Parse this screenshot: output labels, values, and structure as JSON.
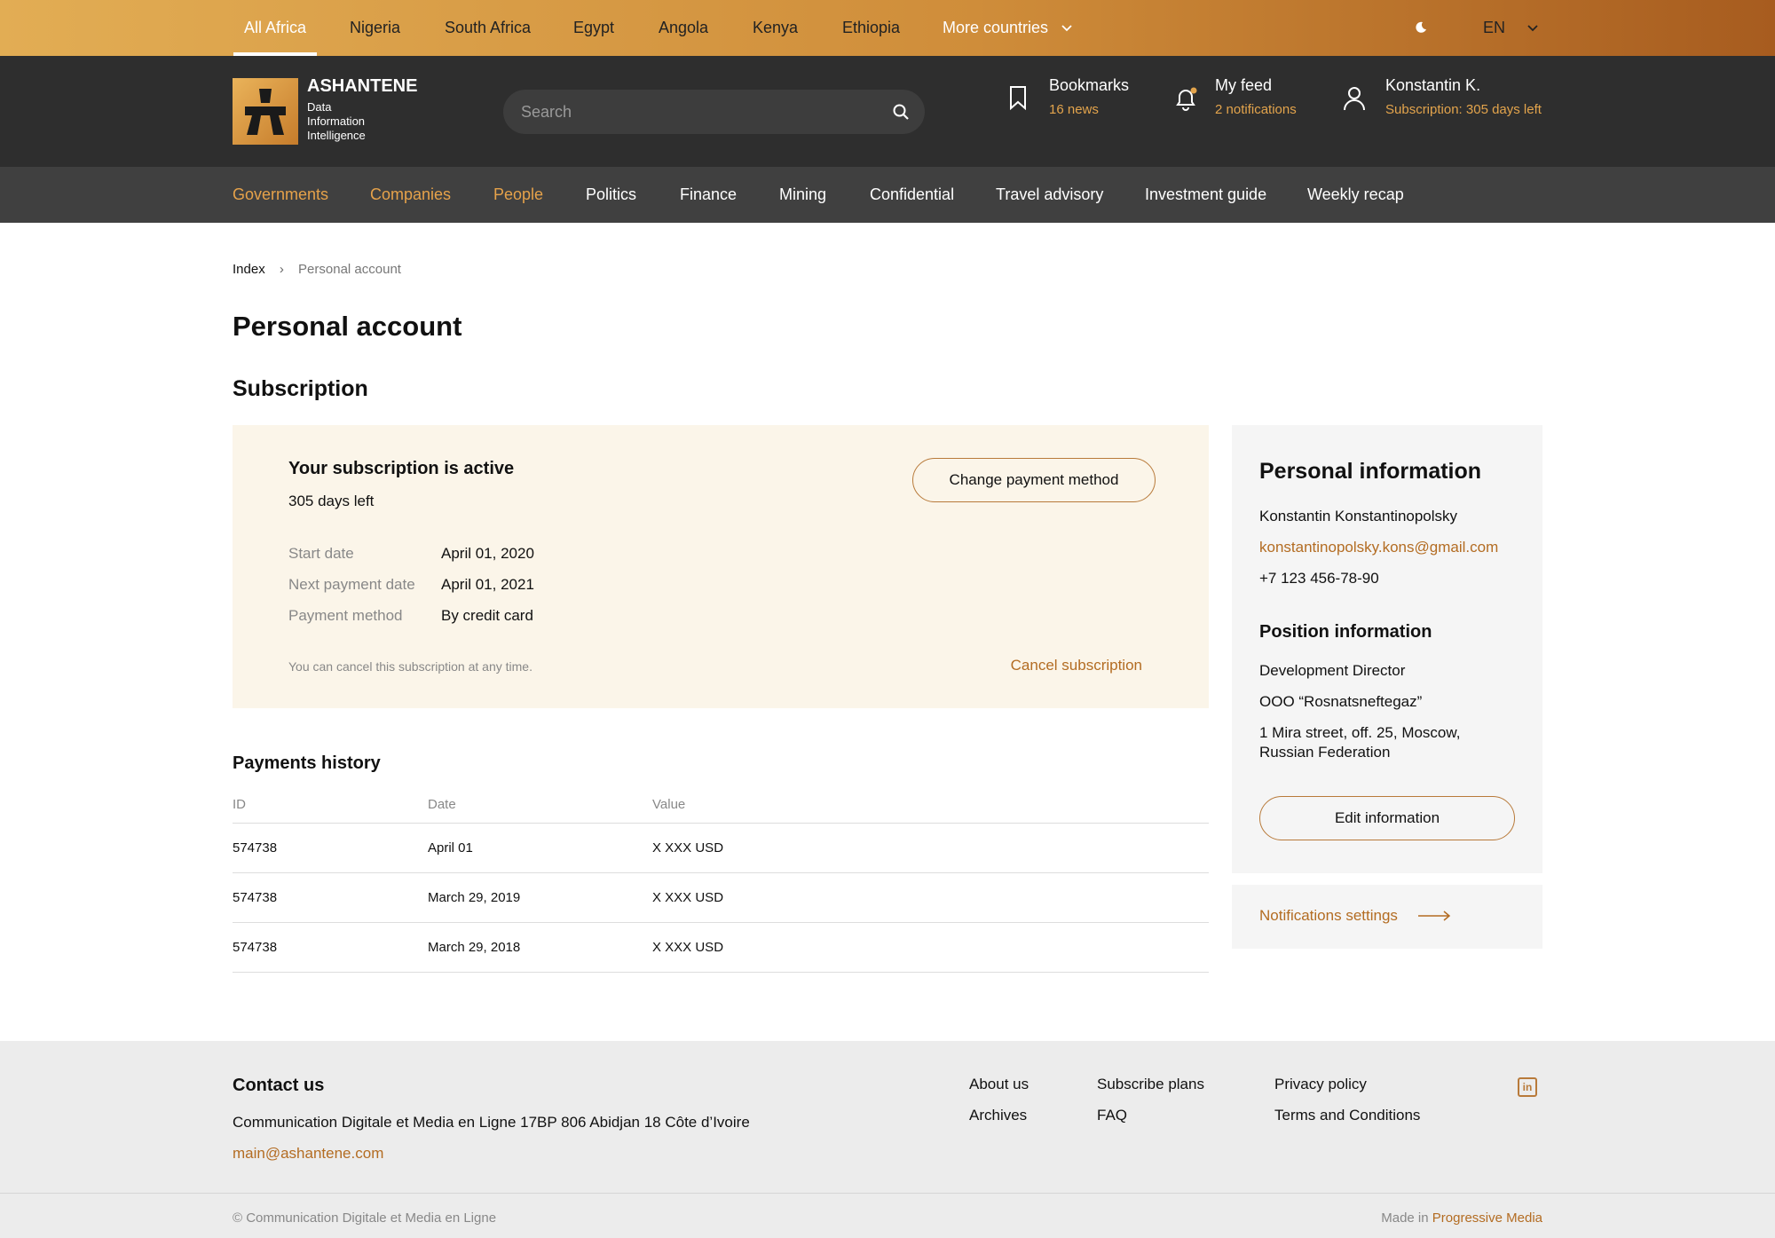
{
  "countries": {
    "items": [
      "All Africa",
      "Nigeria",
      "South Africa",
      "Egypt",
      "Angola",
      "Kenya",
      "Ethiopia"
    ],
    "active": "All Africa",
    "more_label": "More countries",
    "language": "EN"
  },
  "header": {
    "logo_title": "ASHANTENE",
    "logo_sub": [
      "Data",
      "Information",
      "Intelligence"
    ],
    "search_placeholder": "Search",
    "bookmarks_title": "Bookmarks",
    "bookmarks_sub": "16 news",
    "feed_title": "My feed",
    "feed_sub": "2 notifications",
    "user_name": "Konstantin K.",
    "user_sub": "Subscription: 305 days left"
  },
  "nav": {
    "items": [
      "Governments",
      "Companies",
      "People",
      "Politics",
      "Finance",
      "Mining",
      "Confidential",
      "Travel advisory",
      "Investment guide",
      "Weekly recap"
    ]
  },
  "breadcrumb": {
    "root": "Index",
    "current": "Personal account"
  },
  "page_title": "Personal account",
  "subscription": {
    "heading": "Subscription",
    "status": "Your subscription is active",
    "days_left": "305 days left",
    "change_payment_label": "Change payment method",
    "start_label": "Start date",
    "start_value": "April 01, 2020",
    "next_label": "Next payment date",
    "next_value": "April 01, 2021",
    "method_label": "Payment method",
    "method_value": "By credit card",
    "cancel_note": "You can cancel this subscription at any time.",
    "cancel_label": "Cancel subscription"
  },
  "payments": {
    "heading": "Payments history",
    "columns": [
      "ID",
      "Date",
      "Value"
    ],
    "rows": [
      {
        "id": "574738",
        "date": "April 01",
        "value": "X XXX USD"
      },
      {
        "id": "574738",
        "date": "March 29, 2019",
        "value": "X XXX USD"
      },
      {
        "id": "574738",
        "date": "March 29, 2018",
        "value": "X XXX USD"
      }
    ]
  },
  "personal": {
    "heading": "Personal information",
    "name": "Konstantin Konstantinopolsky",
    "email": "konstantinopolsky.kons@gmail.com",
    "phone": "+7 123 456-78-90",
    "position_heading": "Position information",
    "position": "Development Director",
    "company": "OOO “Rosnatsneftegaz”",
    "address_line1": "1 Mira street, off. 25, Moscow,",
    "address_line2": "Russian Federation",
    "edit_label": "Edit information",
    "notifications_label": "Notifications settings"
  },
  "footer": {
    "contact_heading": "Contact us",
    "address": "Communication Digitale et Media en Ligne 17BP 806 Abidjan 18 Côte d’Ivoire",
    "email": "main@ashantene.com",
    "links": {
      "about": "About us",
      "archives": "Archives",
      "plans": "Subscribe plans",
      "faq": "FAQ",
      "privacy": "Privacy policy",
      "terms": "Terms and Conditions"
    },
    "linkedin_icon": "in",
    "copyright": "© Communication Digitale et Media en Ligne",
    "made_in": "Made in",
    "made_by": "Progressive Media"
  },
  "colors": {
    "accent": "#b36c22",
    "gold": "#e3a44c",
    "header_bg": "#2e2e2e",
    "nav_bg": "#404040",
    "card_bg": "#fbf5e9"
  }
}
